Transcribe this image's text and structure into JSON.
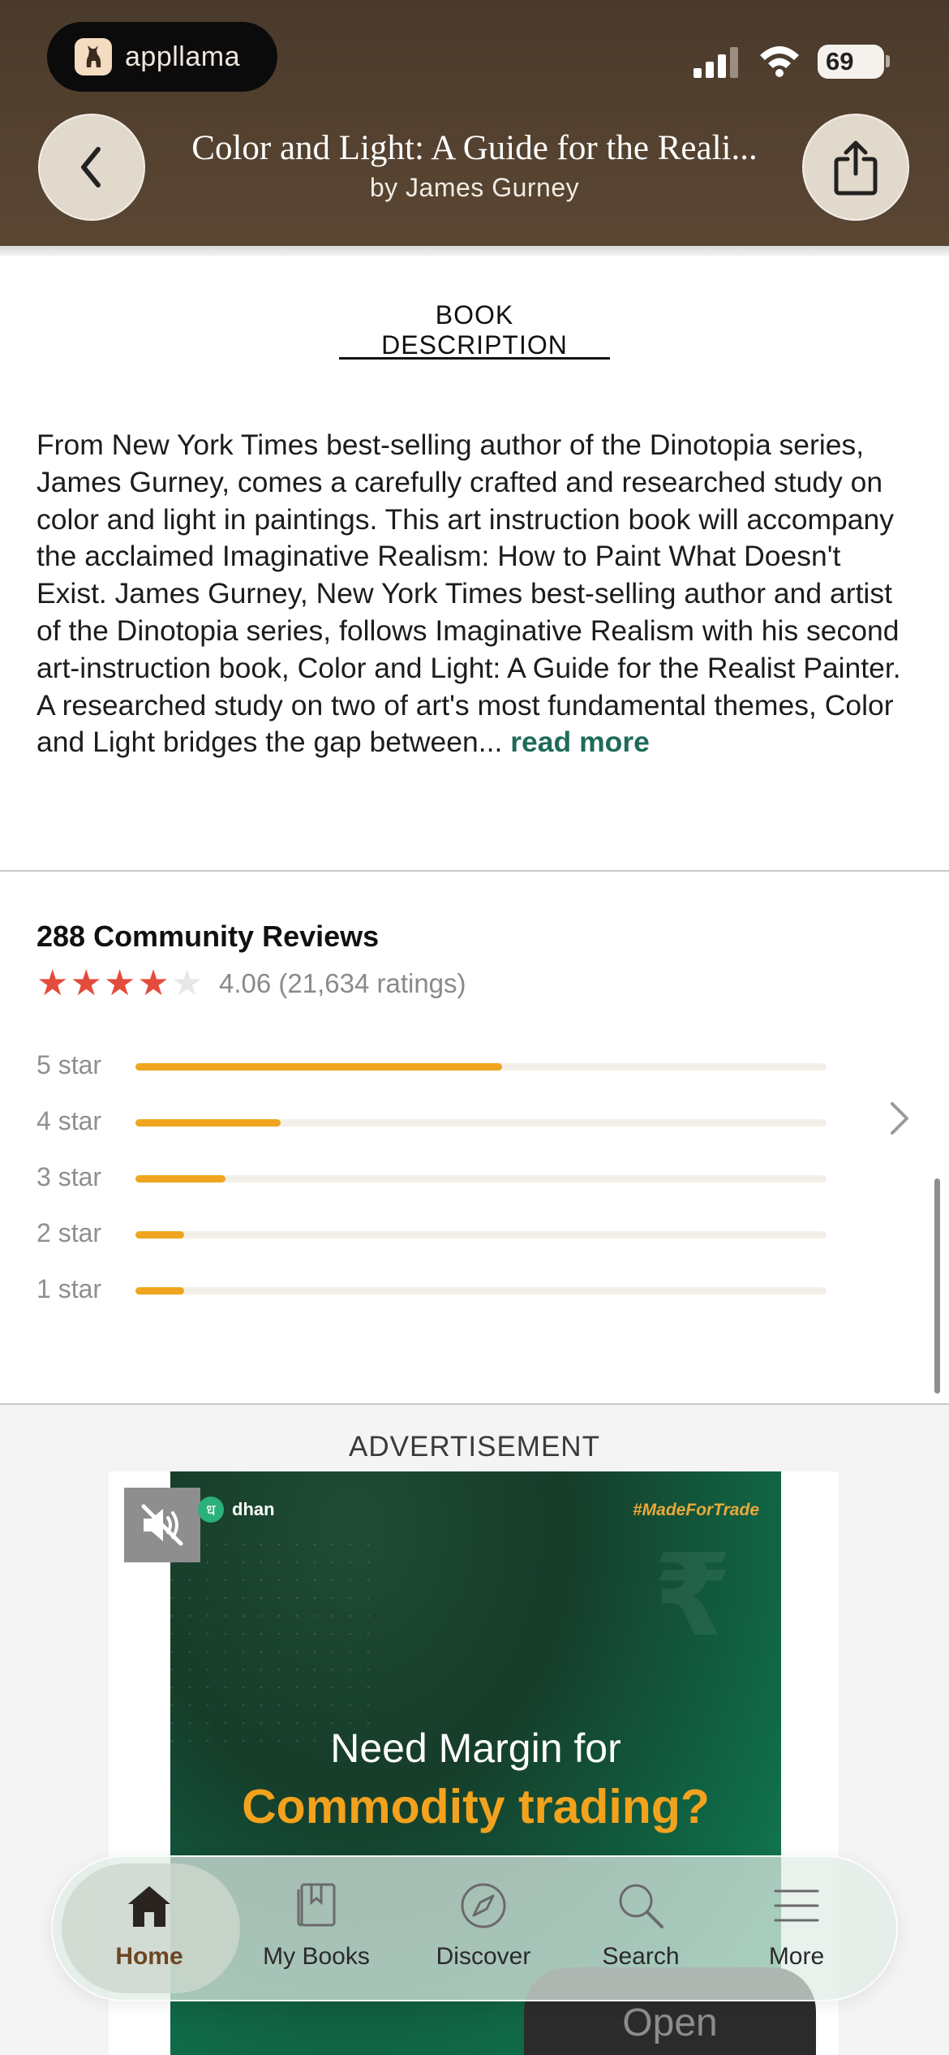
{
  "status_bar": {
    "app_name": "appllama",
    "battery": "69"
  },
  "header": {
    "title": "Color and Light: A Guide for the Reali...",
    "author": "by James Gurney"
  },
  "description": {
    "tab_label": "BOOK DESCRIPTION",
    "text": "From New York Times best-selling author of the Dinotopia series, James Gurney, comes a carefully crafted and researched study on color and light in paintings. This art instruction book will accompany the acclaimed Imaginative Realism: How to Paint What Doesn't Exist. James Gurney, New York Times best-selling author and artist of the Dinotopia series, follows Imaginative Realism with his second art-instruction book, Color and Light: A Guide for the Realist Painter. A researched study on two of art's most fundamental themes, Color and Light bridges the gap between...",
    "read_more": "read more"
  },
  "reviews": {
    "title": "288 Community Reviews",
    "rating_value": 4.06,
    "rating_text": "4.06 (21,634 ratings)",
    "distribution": [
      {
        "label": "5 star",
        "fraction": 0.53
      },
      {
        "label": "4 star",
        "fraction": 0.21
      },
      {
        "label": "3 star",
        "fraction": 0.13
      },
      {
        "label": "2 star",
        "fraction": 0.07
      },
      {
        "label": "1 star",
        "fraction": 0.07
      }
    ]
  },
  "advertisement": {
    "label": "ADVERTISEMENT",
    "brand": "dhan",
    "brand_glyph": "ध",
    "hashtag": "#MadeForTrade",
    "line1": "Need Margin for",
    "line2": "Commodity trading?",
    "cta": "Open",
    "rupee": "₹"
  },
  "tabbar": {
    "items": [
      {
        "label": "Home",
        "icon": "home-icon",
        "active": true
      },
      {
        "label": "My Books",
        "icon": "book-icon",
        "active": false
      },
      {
        "label": "Discover",
        "icon": "compass-icon",
        "active": false
      },
      {
        "label": "Search",
        "icon": "search-icon",
        "active": false
      },
      {
        "label": "More",
        "icon": "menu-icon",
        "active": false
      }
    ]
  },
  "colors": {
    "header_bg": "#54412f",
    "accent_link": "#1f6b5a",
    "star_on": "#e34c3c",
    "bar_fill": "#f0a41f",
    "active_tab": "#6d4523",
    "ad_highlight": "#f3a21d"
  }
}
